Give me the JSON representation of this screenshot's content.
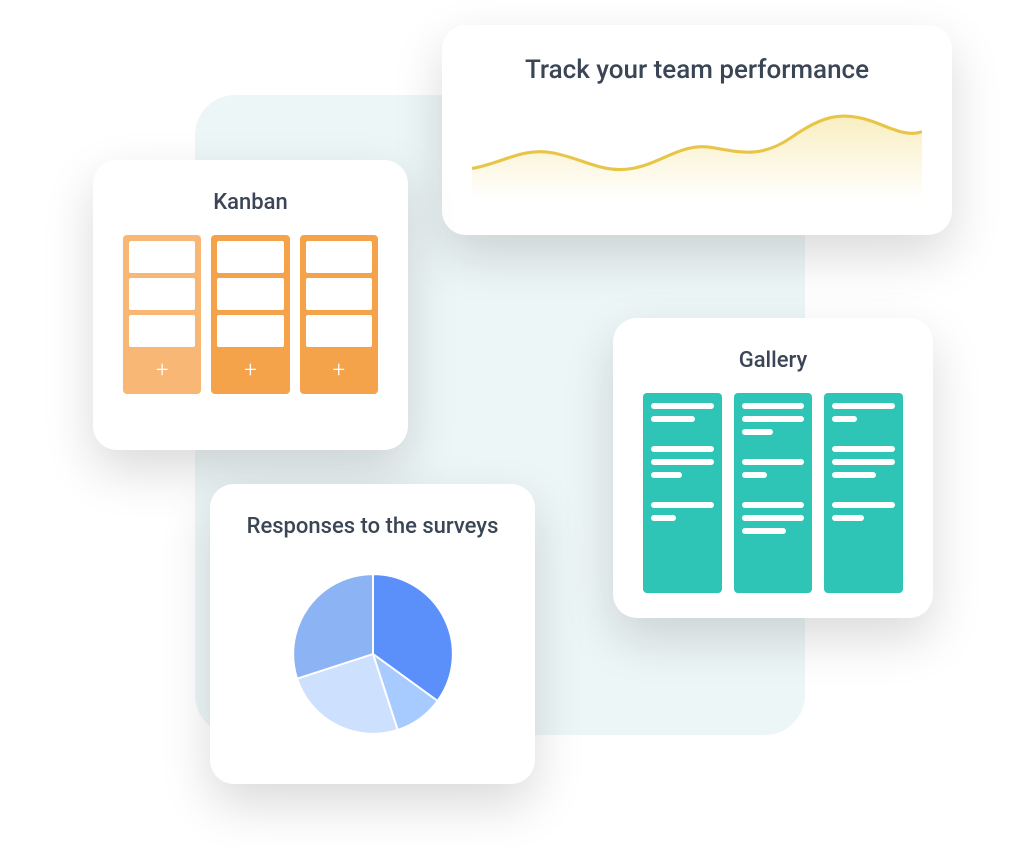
{
  "backdrop": {
    "color": "#EDF6F7"
  },
  "cards": {
    "performance": {
      "title": "Track your team performance",
      "lineColor": "#E8C547"
    },
    "kanban": {
      "title": "Kanban",
      "color": "#F5A34B",
      "columns": 3,
      "rows_per_column": 3
    },
    "gallery": {
      "title": "Gallery",
      "color": "#2EC4B6",
      "columns": 3
    },
    "surveys": {
      "title": "Responses to the surveys"
    }
  },
  "chart_data": {
    "type": "pie",
    "title": "Responses to the surveys",
    "series": [
      {
        "name": "slice-1",
        "value": 35,
        "color": "#5B8FF9"
      },
      {
        "name": "slice-2",
        "value": 10,
        "color": "#A8CBFF"
      },
      {
        "name": "slice-3",
        "value": 25,
        "color": "#CDE1FF"
      },
      {
        "name": "slice-4",
        "value": 30,
        "color": "#8CB4F5"
      }
    ]
  }
}
